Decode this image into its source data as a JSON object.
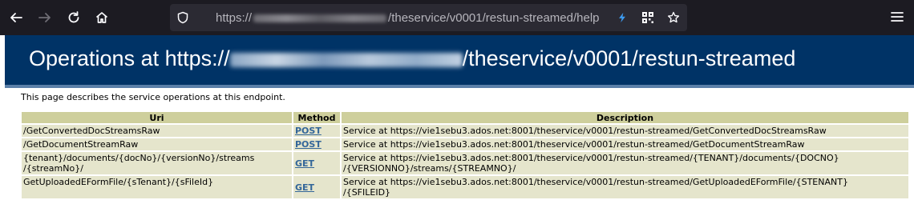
{
  "browser": {
    "url_prefix": "https://",
    "url_suffix": "/theservice/v0001/restun-streamed/help",
    "icons": [
      "back-arrow-icon",
      "forward-arrow-icon",
      "reload-icon",
      "home-icon",
      "shield-icon",
      "lightning-icon",
      "qr-grid-icon",
      "star-icon",
      "hamburger-menu-icon"
    ]
  },
  "banner": {
    "title_prefix": "Operations at https://",
    "title_suffix": "/theservice/v0001/restun-streamed"
  },
  "intro": "This page describes the service operations at this endpoint.",
  "table": {
    "headers": [
      "Uri",
      "Method",
      "Description"
    ],
    "rows": [
      {
        "uri": "/GetConvertedDocStreamsRaw",
        "method": "POST",
        "desc1": "Service at https://vie1sebu3.ados.net:8001/theservice/v0001/restun-streamed/GetConvertedDocStreamsRaw",
        "desc2": ""
      },
      {
        "uri": "/GetDocumentStreamRaw",
        "method": "POST",
        "desc1": "Service at https://vie1sebu3.ados.net:8001/theservice/v0001/restun-streamed/GetDocumentStreamRaw",
        "desc2": ""
      },
      {
        "uri1": "{tenant}/documents/{docNo}/{versionNo}/streams",
        "uri2": "/{streamNo}/",
        "method": "GET",
        "desc1": "Service at https://vie1sebu3.ados.net:8001/theservice/v0001/restun-streamed/{TENANT}/documents/{DOCNO}",
        "desc2": "/{VERSIONNO}/streams/{STREAMNO}/"
      },
      {
        "uri": "GetUploadedEFormFile/{sTenant}/{sFileId}",
        "method": "GET",
        "desc1": "Service at https://vie1sebu3.ados.net:8001/theservice/v0001/restun-streamed/GetUploadedEFormFile/{STENANT}",
        "desc2": "/{SFILEID}"
      }
    ]
  }
}
